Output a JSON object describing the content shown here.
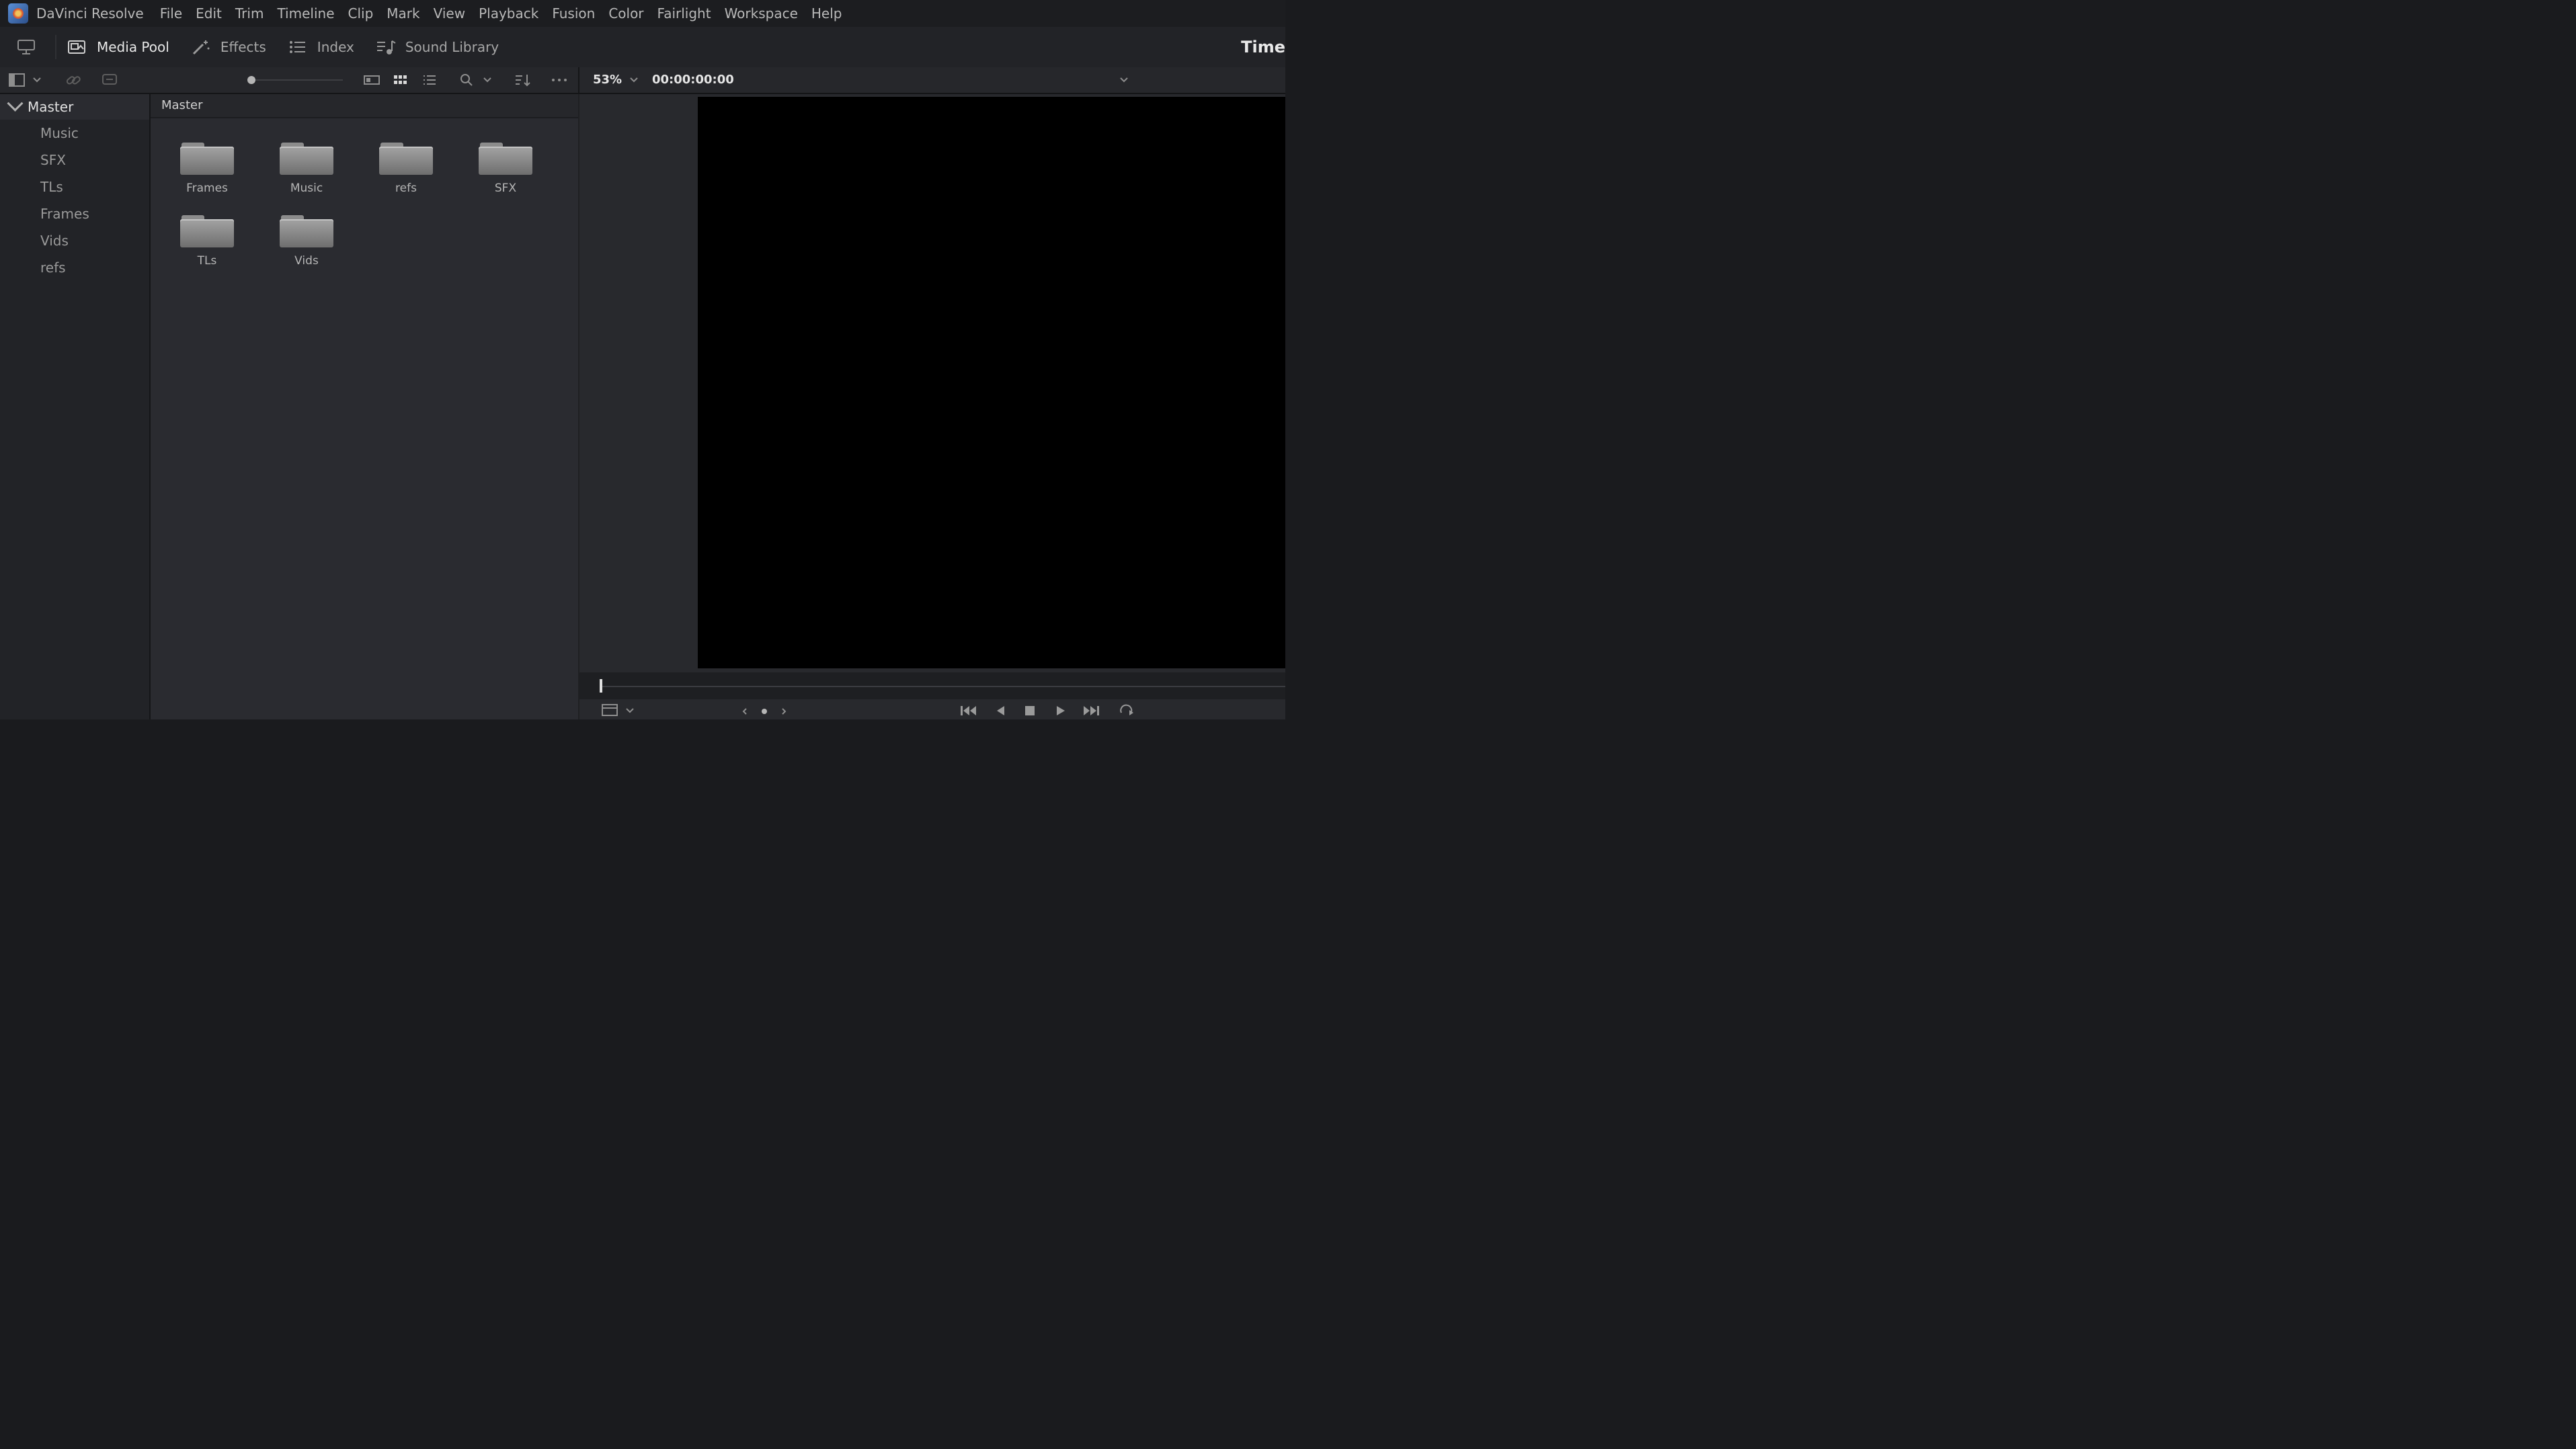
{
  "menubar": {
    "app_name": "DaVinci Resolve",
    "items": [
      "File",
      "Edit",
      "Trim",
      "Timeline",
      "Clip",
      "Mark",
      "View",
      "Playback",
      "Fusion",
      "Color",
      "Fairlight",
      "Workspace",
      "Help"
    ]
  },
  "toolbar": {
    "media_pool": "Media Pool",
    "effects": "Effects",
    "index": "Index",
    "sound_library": "Sound Library",
    "right_title": "Time"
  },
  "viewer_bar": {
    "zoom": "53%",
    "timecode": "00:00:00:00"
  },
  "bins": {
    "master": "Master",
    "items": [
      "Music",
      "SFX",
      "TLs",
      "Frames",
      "Vids",
      "refs"
    ]
  },
  "pool": {
    "header": "Master",
    "folders": [
      "Frames",
      "Music",
      "refs",
      "SFX",
      "TLs",
      "Vids"
    ]
  },
  "colors": {
    "accent": "#5b8fd6",
    "panel": "#222327",
    "viewer": "#000000"
  }
}
